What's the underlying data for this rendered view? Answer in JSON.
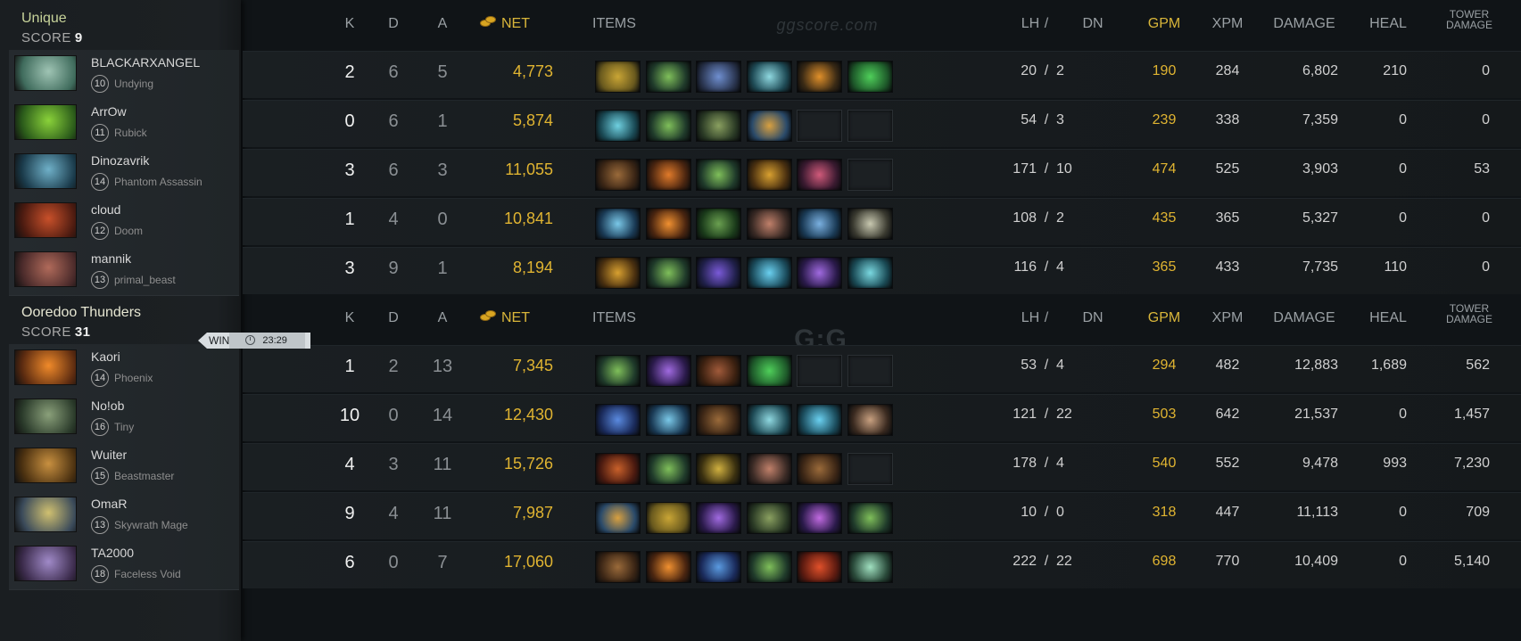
{
  "watermark": "ggscore.com",
  "logo": {
    "mark": "G:G",
    "sub": "ggscore.com"
  },
  "headers": {
    "k": "K",
    "d": "D",
    "a": "A",
    "net": "NET",
    "items": "ITEMS",
    "lh": "LH",
    "slash": "/",
    "dn": "DN",
    "gpm": "GPM",
    "xpm": "XPM",
    "damage": "DAMAGE",
    "heal": "HEAL",
    "tower1": "TOWER",
    "tower2": "DAMAGE"
  },
  "result": {
    "label": "WIN",
    "duration": "23:29"
  },
  "teams": [
    {
      "name": "Unique",
      "score_label": "SCORE",
      "score": "9",
      "players": [
        {
          "name": "BLACKARXANGEL",
          "level": "10",
          "hero": "Undying",
          "k": "2",
          "d": "6",
          "a": "5",
          "net": "4,773",
          "lh": "20",
          "dn": "2",
          "gpm": "190",
          "xpm": "284",
          "damage": "6,802",
          "heal": "210",
          "tower": "0",
          "portrait": [
            "#3f6b5c",
            "#9fc4b4"
          ],
          "items": [
            [
              "#6a5a1e",
              "#c9a535"
            ],
            [
              "#1f3a2a",
              "#7fbf5a"
            ],
            [
              "#2a3550",
              "#6f8fd0"
            ],
            [
              "#1e4a55",
              "#8fd8e0"
            ],
            [
              "#3a2a15",
              "#e0902a"
            ],
            [
              "#1e5a2a",
              "#4fcf5a"
            ]
          ]
        },
        {
          "name": "ArrOw",
          "level": "11",
          "hero": "Rubick",
          "k": "0",
          "d": "6",
          "a": "1",
          "net": "5,874",
          "lh": "54",
          "dn": "3",
          "gpm": "239",
          "xpm": "338",
          "damage": "7,359",
          "heal": "0",
          "tower": "0",
          "portrait": [
            "#2a5a1a",
            "#8ad23a"
          ],
          "items": [
            [
              "#1a4a55",
              "#6fd0e0"
            ],
            [
              "#1f3a2a",
              "#7fbf5a"
            ],
            [
              "#2a3a25",
              "#8aa060"
            ],
            [
              "#2a4a6a",
              "#d8a040"
            ],
            null,
            null
          ]
        },
        {
          "name": "Dinozavrik",
          "level": "14",
          "hero": "Phantom Assassin",
          "k": "3",
          "d": "6",
          "a": "3",
          "net": "11,055",
          "lh": "171",
          "dn": "10",
          "gpm": "474",
          "xpm": "525",
          "damage": "3,903",
          "heal": "0",
          "tower": "53",
          "portrait": [
            "#1a3a4a",
            "#6fb0c8"
          ],
          "items": [
            [
              "#3a2515",
              "#9a6a3a"
            ],
            [
              "#4a2510",
              "#e07a2a"
            ],
            [
              "#1f3a2a",
              "#7fbf5a"
            ],
            [
              "#4a3010",
              "#d8a030"
            ],
            [
              "#3a1a30",
              "#d05a7a"
            ],
            null
          ]
        },
        {
          "name": "cloud",
          "level": "12",
          "hero": "Doom",
          "k": "1",
          "d": "4",
          "a": "0",
          "net": "10,841",
          "lh": "108",
          "dn": "2",
          "gpm": "435",
          "xpm": "365",
          "damage": "5,327",
          "heal": "0",
          "tower": "0",
          "portrait": [
            "#4a1a10",
            "#c8502a"
          ],
          "items": [
            [
              "#1a3a55",
              "#7ac8e8"
            ],
            [
              "#4a2510",
              "#f09030"
            ],
            [
              "#1a3a1a",
              "#6aa050"
            ],
            [
              "#3a2a25",
              "#c0806a"
            ],
            [
              "#1a3a55",
              "#7ab0e0"
            ],
            [
              "#3a3a30",
              "#c8c8b0"
            ]
          ]
        },
        {
          "name": "mannik",
          "level": "13",
          "hero": "primal_beast",
          "k": "3",
          "d": "9",
          "a": "1",
          "net": "8,194",
          "lh": "116",
          "dn": "4",
          "gpm": "365",
          "xpm": "433",
          "damage": "7,735",
          "heal": "110",
          "tower": "0",
          "portrait": [
            "#4a2a2a",
            "#b06a5a"
          ],
          "items": [
            [
              "#4a3010",
              "#d8a030"
            ],
            [
              "#1f3a2a",
              "#7fbf5a"
            ],
            [
              "#20204a",
              "#7a5ad8"
            ],
            [
              "#1a4a5a",
              "#6ad0f0"
            ],
            [
              "#2a1a4a",
              "#a06ae0"
            ],
            [
              "#1a4a55",
              "#7ad8e0"
            ]
          ]
        }
      ]
    },
    {
      "name": "Ooredoo Thunders",
      "score_label": "SCORE",
      "score": "31",
      "players": [
        {
          "name": "Kaori",
          "level": "14",
          "hero": "Phoenix",
          "k": "1",
          "d": "2",
          "a": "13",
          "net": "7,345",
          "lh": "53",
          "dn": "4",
          "gpm": "294",
          "xpm": "482",
          "damage": "12,883",
          "heal": "1,689",
          "tower": "562",
          "portrait": [
            "#5a2a10",
            "#f08a2a"
          ],
          "items": [
            [
              "#1f3a2a",
              "#7fbf5a"
            ],
            [
              "#2a1a4a",
              "#a06ae0"
            ],
            [
              "#3a2010",
              "#a05a3a"
            ],
            [
              "#1e5a2a",
              "#4fcf5a"
            ],
            null,
            null
          ]
        },
        {
          "name": "No!ob",
          "level": "16",
          "hero": "Tiny",
          "k": "10",
          "d": "0",
          "a": "14",
          "net": "12,430",
          "lh": "121",
          "dn": "22",
          "gpm": "503",
          "xpm": "642",
          "damage": "21,537",
          "heal": "0",
          "tower": "1,457",
          "portrait": [
            "#2a3a2a",
            "#8aa07a"
          ],
          "items": [
            [
              "#1a2a5a",
              "#5a8ae0"
            ],
            [
              "#1a3a55",
              "#7ac8e8"
            ],
            [
              "#3a2515",
              "#9a6a3a"
            ],
            [
              "#1e4a55",
              "#8fd8e0"
            ],
            [
              "#1a4a5a",
              "#6ad0f0"
            ],
            [
              "#3a2a20",
              "#c8a080"
            ]
          ]
        },
        {
          "name": "Wuiter",
          "level": "15",
          "hero": "Beastmaster",
          "k": "4",
          "d": "3",
          "a": "11",
          "net": "15,726",
          "lh": "178",
          "dn": "4",
          "gpm": "540",
          "xpm": "552",
          "damage": "9,478",
          "heal": "993",
          "tower": "7,230",
          "portrait": [
            "#4a3010",
            "#c89040"
          ],
          "items": [
            [
              "#4a1a10",
              "#c8602a"
            ],
            [
              "#1f3a2a",
              "#7fbf5a"
            ],
            [
              "#3a3010",
              "#d0b040"
            ],
            [
              "#3a2a25",
              "#c0806a"
            ],
            [
              "#3a2515",
              "#9a6a3a"
            ],
            null
          ]
        },
        {
          "name": "OmaR",
          "level": "13",
          "hero": "Skywrath Mage",
          "k": "9",
          "d": "4",
          "a": "11",
          "net": "7,987",
          "lh": "10",
          "dn": "0",
          "gpm": "318",
          "xpm": "447",
          "damage": "11,113",
          "heal": "0",
          "tower": "709",
          "portrait": [
            "#3a4a5a",
            "#d0c070"
          ],
          "items": [
            [
              "#2a4a6a",
              "#d8a040"
            ],
            [
              "#6a5a1e",
              "#c9a535"
            ],
            [
              "#2a1a4a",
              "#a06ae0"
            ],
            [
              "#2a3a25",
              "#8aa060"
            ],
            [
              "#2a1a4a",
              "#c06ae0"
            ],
            [
              "#1f3a2a",
              "#7fbf5a"
            ]
          ]
        },
        {
          "name": "TA2000",
          "level": "18",
          "hero": "Faceless Void",
          "k": "6",
          "d": "0",
          "a": "7",
          "net": "17,060",
          "lh": "222",
          "dn": "22",
          "gpm": "698",
          "xpm": "770",
          "damage": "10,409",
          "heal": "0",
          "tower": "5,140",
          "portrait": [
            "#3a2a4a",
            "#a08ac8"
          ],
          "items": [
            [
              "#3a2515",
              "#9a6a3a"
            ],
            [
              "#4a2510",
              "#f09030"
            ],
            [
              "#1a2a5a",
              "#5a9ae0"
            ],
            [
              "#1f3a2a",
              "#7fbf5a"
            ],
            [
              "#5a1a10",
              "#e0502a"
            ],
            [
              "#2a4a3a",
              "#a0e0c0"
            ]
          ]
        }
      ]
    }
  ]
}
